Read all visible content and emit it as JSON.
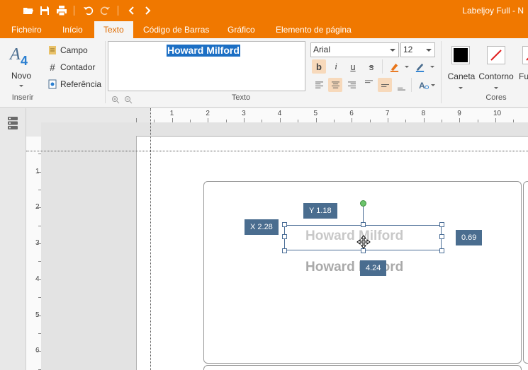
{
  "title_bar": {
    "app_title": "Labeljoy Full - N",
    "quick_access": [
      "open-icon",
      "save-icon",
      "print-icon",
      "undo-icon",
      "redo-icon",
      "back-icon",
      "forward-icon"
    ]
  },
  "tabs": [
    {
      "label": "Ficheiro",
      "active": false
    },
    {
      "label": "Início",
      "active": false
    },
    {
      "label": "Texto",
      "active": true
    },
    {
      "label": "Código de Barras",
      "active": false
    },
    {
      "label": "Gráfico",
      "active": false
    },
    {
      "label": "Elemento de página",
      "active": false
    }
  ],
  "ribbon": {
    "inserir": {
      "novo_label": "Novo",
      "group_label": "Inserir",
      "campo_label": "Campo",
      "contador_label": "Contador",
      "referencia_label": "Referência"
    },
    "texto": {
      "value": "Howard Milford",
      "group_label": "Texto",
      "font": "Arial",
      "size": "12"
    },
    "cores": {
      "caneta_label": "Caneta",
      "contorno_label": "Contorno",
      "fundo_label": "Fu",
      "group_label": "Cores",
      "caneta_color": "#000000",
      "contorno_color": "#e02020"
    }
  },
  "rulers": {
    "top_numbers": [
      "1",
      "2",
      "3",
      "4",
      "5",
      "6",
      "7",
      "8",
      "9",
      "10"
    ],
    "left_numbers": [
      "1",
      "2",
      "3",
      "4",
      "5",
      "6"
    ]
  },
  "canvas": {
    "ghost_text_1": "Howard Milford",
    "ghost_text_2": "Howard Milford",
    "tag_x": "X 2.28",
    "tag_y": "Y 1.18",
    "tag_width": "4.24",
    "tag_height": "0.69"
  }
}
